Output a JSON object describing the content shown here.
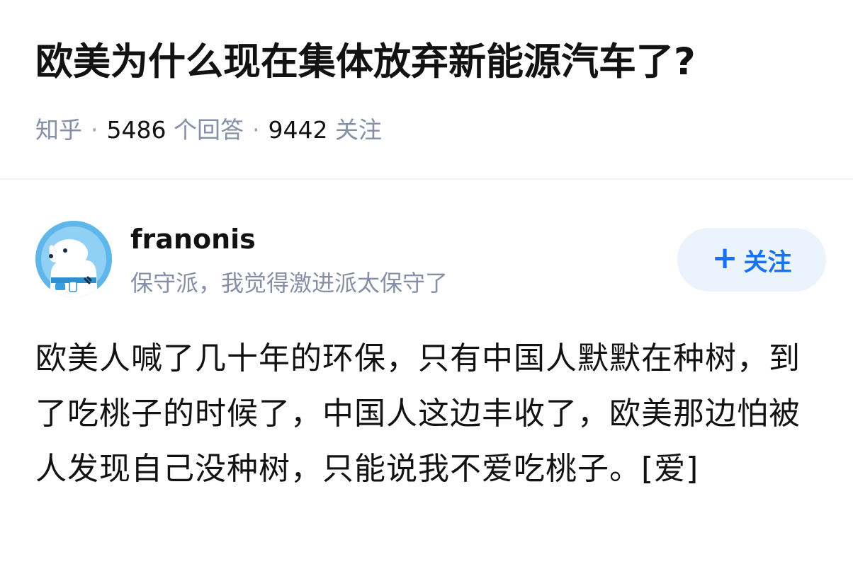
{
  "question": {
    "title": "欧美为什么现在集体放弃新能源汽车了?",
    "source": "知乎",
    "answers_count": "5486",
    "answers_label": "个回答",
    "followers_count": "9442",
    "followers_label": "关注",
    "separator": "·"
  },
  "author": {
    "name": "franonis",
    "bio": "保守派，我觉得激进派太保守了",
    "avatar_icon": "dog-avatar-icon"
  },
  "follow_button": {
    "plus": "+",
    "label": "关注"
  },
  "answer": {
    "text": "欧美人喊了几十年的环保，只有中国人默默在种树，到了吃桃子的时候了，中国人这边丰收了，欧美那边怕被人发现自己没种树，只能说我不爱吃桃子。[爱]"
  },
  "colors": {
    "accent": "#1772f6",
    "button_bg": "#ebf3fd",
    "meta_gray": "#8590a6",
    "text": "#121212",
    "avatar_bg": "#5eb6ea"
  }
}
